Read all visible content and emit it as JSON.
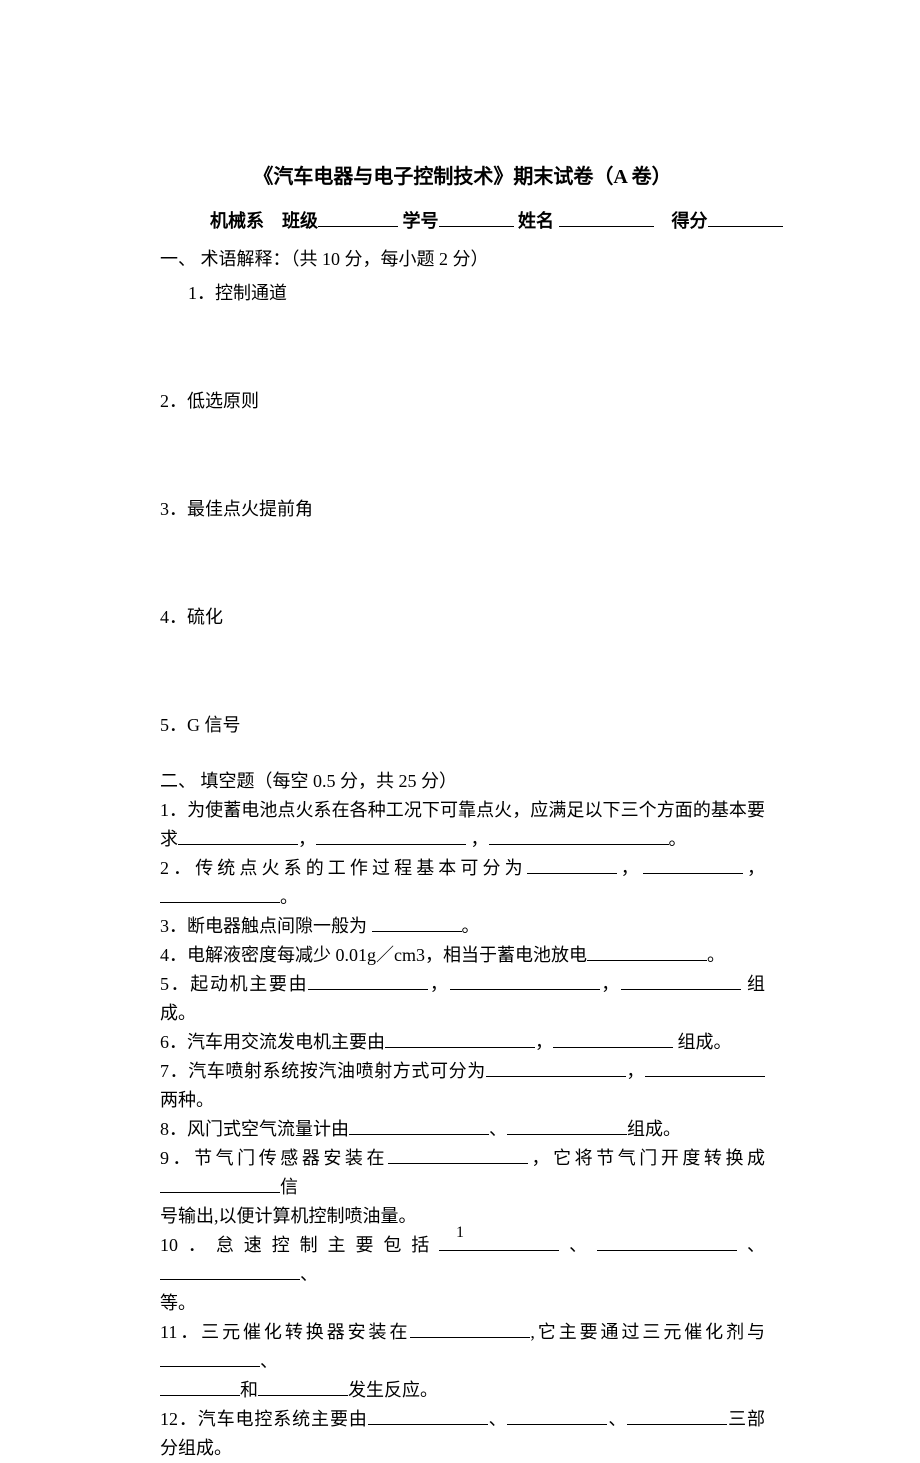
{
  "title": "《汽车电器与电子控制技术》期末试卷（A 卷）",
  "header": {
    "dept": "机械系",
    "class_label": "班级",
    "id_label": "学号",
    "name_label": "姓名",
    "score_label": "得分"
  },
  "section1": {
    "header": "一、 术语解释：（共 10 分，每小题 2 分）",
    "items": {
      "i1": "1．控制通道",
      "i2": "2．低选原则",
      "i3": "3．最佳点火提前角",
      "i4": "4．硫化",
      "i5": "5．G 信号"
    }
  },
  "section2": {
    "header": "二、 填空题（每空 0.5 分，共 25 分）",
    "q1a": "1．为使蓄电池点火系在各种工况下可靠点火，应满足以下三个方面的基本要",
    "q1b": "求",
    "q2": "2．传统点火系的工作过程基本可分为",
    "q3": "3．断电器触点间隙一般为 ",
    "q4a": "4．电解液密度每减少 0.01g／cm3，相当于蓄电池放电",
    "q5a": "5．起动机主要由",
    "q5b": " 组成。",
    "q6a": "6．汽车用交流发电机主要由",
    "q6b": " 组成。",
    "q7a": "7．汽车喷射系统按汽油喷射方式可分为",
    "q7b": " 两种。",
    "q8a": "8．风门式空气流量计由",
    "q8b": "组成。",
    "q9a": "9．节气门传感器安装在",
    "q9b": "，它将节气门开度转换成",
    "q9c": "信",
    "q9d": "号输出,以便计算机控制喷油量。",
    "q10a": "10．怠速控制主要包括",
    "q10b": "等。",
    "q11a": "11．三元催化转换器安装在",
    "q11b": ",它主要通过三元催化剂与",
    "q11c": "和",
    "q11d": "发生反应。",
    "q12a": "12．汽车电控系统主要由",
    "q12b": "三部分组成。"
  },
  "page_number": "1"
}
